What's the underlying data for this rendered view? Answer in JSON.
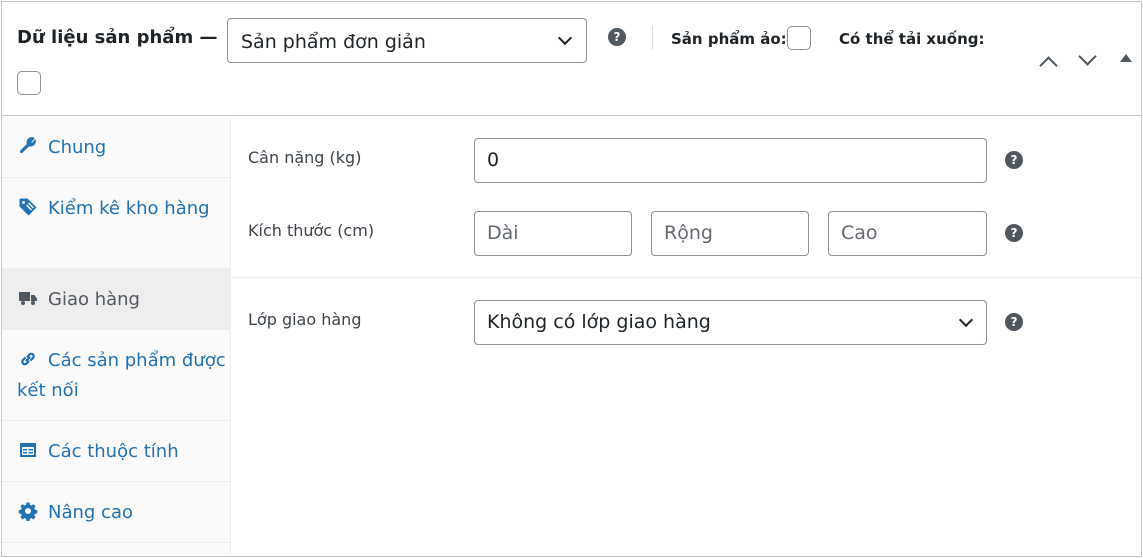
{
  "header": {
    "title": "Dữ liệu sản phẩm —",
    "product_type": {
      "selected": "Sản phẩm đơn giản"
    },
    "virtual_label": "Sản phẩm ảo:",
    "downloadable_label": "Có thể tải xuống:",
    "help_glyph": "?"
  },
  "sidebar": {
    "tabs": [
      {
        "label": "Chung",
        "icon": "wrench-icon"
      },
      {
        "label": "Kiểm kê kho hàng",
        "icon": "tag-icon"
      },
      {
        "label": "Giao hàng",
        "icon": "truck-icon",
        "active": true
      },
      {
        "label": "Các sản phẩm được kết nối",
        "icon": "link-icon"
      },
      {
        "label": "Các thuộc tính",
        "icon": "table-icon"
      },
      {
        "label": "Nâng cao",
        "icon": "gear-icon"
      }
    ]
  },
  "shipping": {
    "weight": {
      "label": "Cân nặng (kg)",
      "value": "0"
    },
    "dimensions": {
      "label": "Kích thước (cm)",
      "length_placeholder": "Dài",
      "width_placeholder": "Rộng",
      "height_placeholder": "Cao"
    },
    "shipping_class": {
      "label": "Lớp giao hàng",
      "selected": "Không có lớp giao hàng"
    }
  },
  "colors": {
    "link": "#2271b1",
    "text": "#1d2327",
    "border": "#8c8f94",
    "active_tab_bg": "#eeeeee"
  }
}
